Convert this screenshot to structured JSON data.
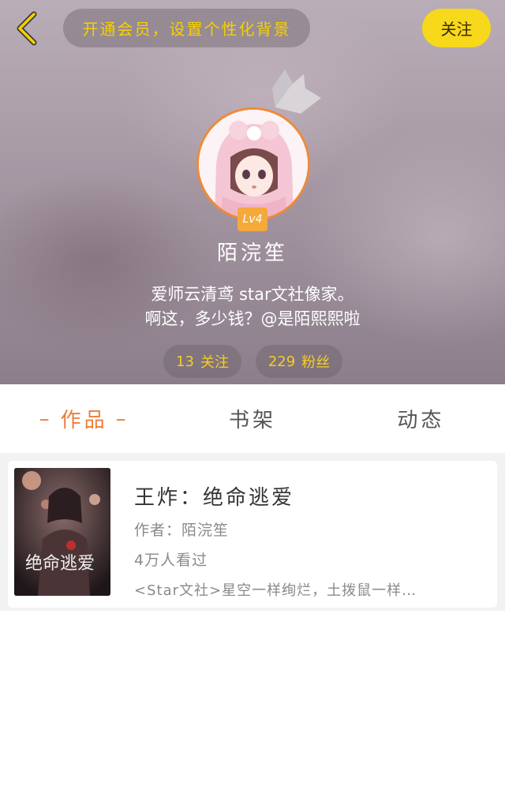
{
  "header": {
    "vip_banner": "开通会员，设置个性化背景",
    "follow_button": "关注",
    "level": "Lv4",
    "username": "陌浣笙",
    "bio_line1": "爱师云清鸢 star文社像家。",
    "bio_line2": "啊这，多少钱？@是陌熙熙啦",
    "stats": {
      "following_count": "13",
      "following_label": "关注",
      "fans_count": "229",
      "fans_label": "粉丝"
    }
  },
  "tabs": [
    {
      "label": "作品",
      "active": true
    },
    {
      "label": "书架",
      "active": false
    },
    {
      "label": "动态",
      "active": false
    }
  ],
  "books": [
    {
      "title": "王炸：绝命逃爱",
      "author": "作者：陌浣笙",
      "views": "4万人看过",
      "description": "<Star文社>星空一样绚烂，土拨鼠一样…",
      "cover_text": "绝命逃爱"
    }
  ],
  "colors": {
    "accent_orange": "#ec7d3a",
    "follow_yellow": "#f7d81b",
    "level_badge": "#f4a93a",
    "stat_text": "#f3cd2a"
  },
  "icons": {
    "back": "chevron-left-icon",
    "crown": "crown-icon"
  }
}
